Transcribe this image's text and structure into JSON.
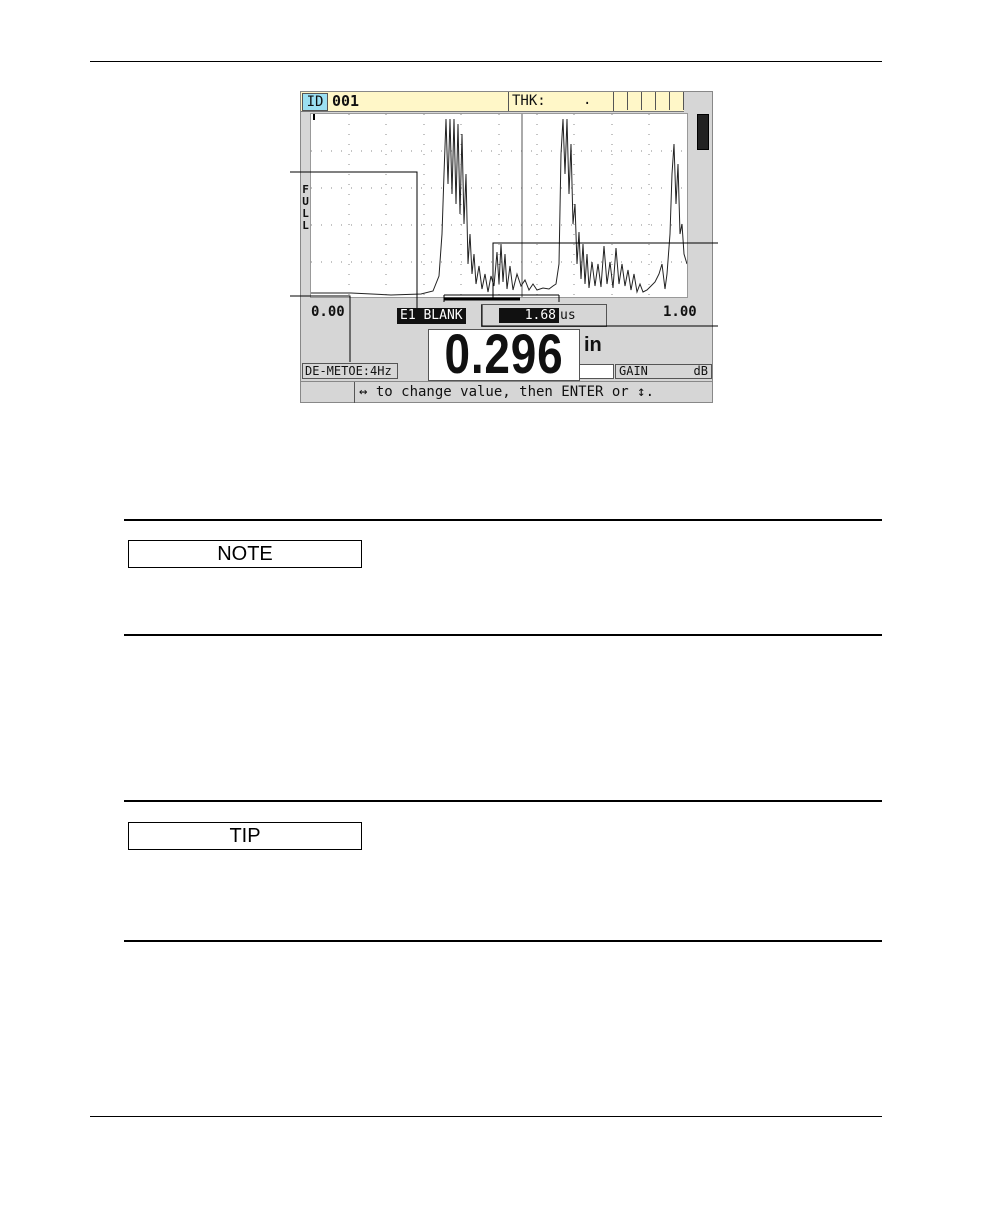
{
  "screen": {
    "id_label": "ID",
    "id_value": "001",
    "thk_label": "THK:",
    "thk_value": ".",
    "range_label": "FULL",
    "x_min": "0.00",
    "x_max": "1.00",
    "e1_blank_label": "E1 BLANK",
    "blank_value": "1.68",
    "blank_unit": "us",
    "thickness_value": "0.296",
    "thickness_unit": "in",
    "gain_label": "GAIN",
    "gain_unit": "dB",
    "mode_label": "DE-METOE:4Hz",
    "help_text": "↔ to change value, then ENTER or ↕."
  },
  "note": {
    "label": "NOTE"
  },
  "tip": {
    "label": "TIP"
  }
}
